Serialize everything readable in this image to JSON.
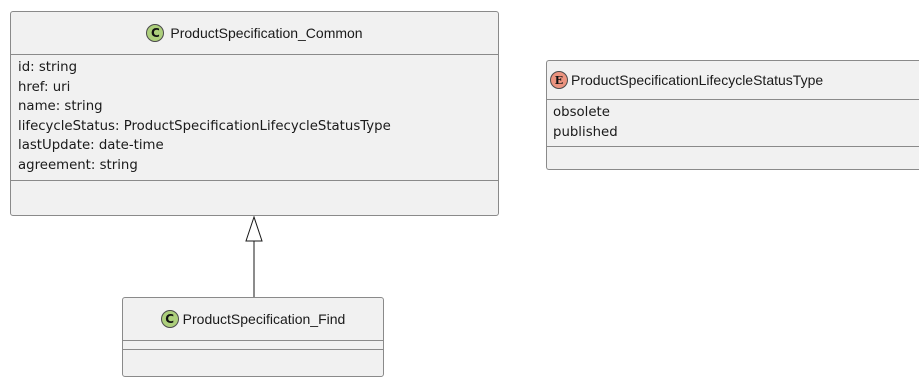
{
  "classes": {
    "common": {
      "stereotype": "C",
      "name": "ProductSpecification_Common",
      "fields": [
        "id: string",
        "href: uri",
        "name: string",
        "lifecycleStatus: ProductSpecificationLifecycleStatusType",
        "lastUpdate: date-time",
        "agreement: string"
      ]
    },
    "lifecycle_enum": {
      "stereotype": "E",
      "name": "ProductSpecificationLifecycleStatusType",
      "values": [
        "obsolete",
        "published"
      ]
    },
    "find": {
      "stereotype": "C",
      "name": "ProductSpecification_Find"
    }
  },
  "colors": {
    "class_fill": "#f1f1f1",
    "border": "#8a8a8a",
    "class_badge": "#adcf7c",
    "enum_badge": "#eb937f"
  }
}
